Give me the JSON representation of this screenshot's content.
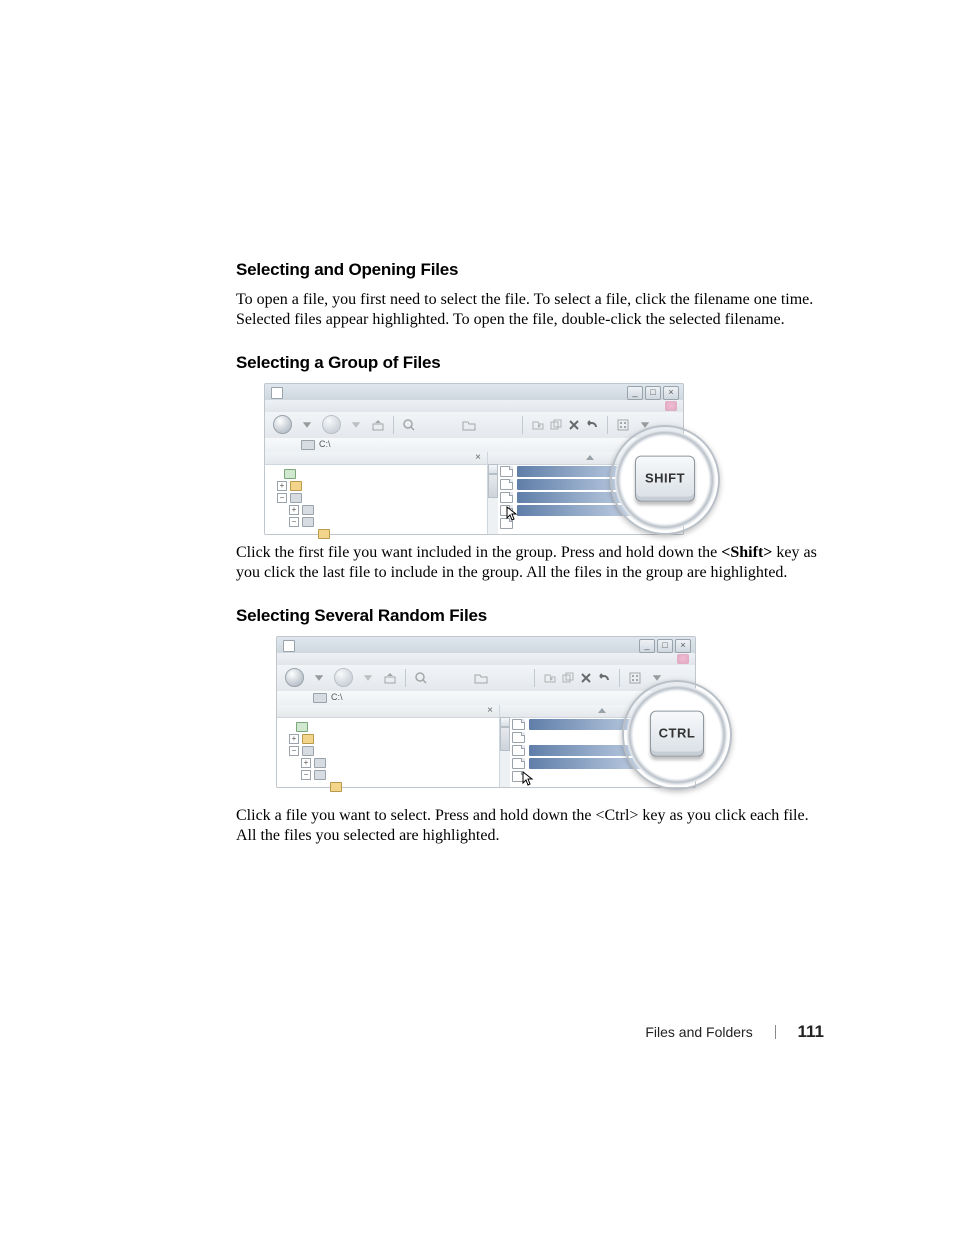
{
  "sections": {
    "s1": {
      "heading": "Selecting and Opening Files",
      "para": "To open a file, you first need to select the file. To select a file, click the filename one time. Selected files appear highlighted. To open the file, double-click the selected filename."
    },
    "s2": {
      "heading": "Selecting a Group of Files",
      "para_a": "Click the first file you want included in the group. Press and hold down the ",
      "key": "<Shift>",
      "para_b": " key as you click the last file to include in the group. All the files in the group are highlighted."
    },
    "s3": {
      "heading": "Selecting Several Random Files",
      "para_a": "Click a file you want to select. Press and hold down the ",
      "key": "<Ctrl>",
      "para_b": " key as you click each file. All the files you selected are highlighted."
    }
  },
  "figure1": {
    "address_path": "C:\\",
    "keycap": "SHIFT",
    "tree_close": "×",
    "win_min": "_",
    "win_max": "□",
    "win_close": "×",
    "tree": {
      "plus": "+",
      "minus": "−"
    }
  },
  "figure2": {
    "address_path": "C:\\",
    "keycap": "CTRL",
    "tree_close": "×",
    "win_min": "_",
    "win_max": "□",
    "win_close": "×",
    "tree": {
      "plus": "+",
      "minus": "−"
    }
  },
  "footer": {
    "chapter": "Files and Folders",
    "page": "111"
  }
}
